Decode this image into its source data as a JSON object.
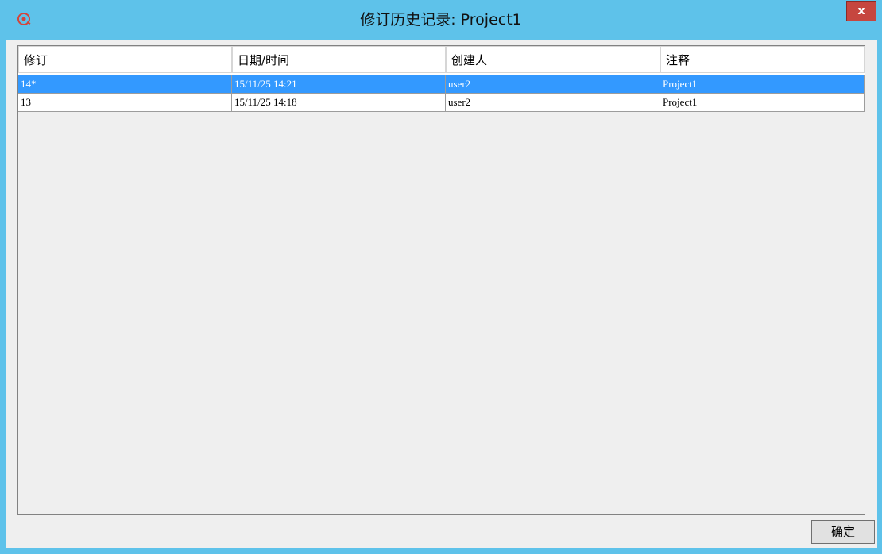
{
  "window": {
    "title": "修订历史记录: Project1",
    "close_label": "x",
    "app_icon": "app-logo-icon"
  },
  "table": {
    "columns": [
      "修订",
      "日期/时间",
      "创建人",
      "注释"
    ],
    "rows": [
      {
        "revision": "14*",
        "datetime": "15/11/25 14:21",
        "creator": "user2",
        "comment": "Project1",
        "selected": true
      },
      {
        "revision": "13",
        "datetime": "15/11/25 14:18",
        "creator": "user2",
        "comment": "Project1",
        "selected": false
      }
    ]
  },
  "footer": {
    "ok_label": "确定"
  },
  "colors": {
    "titlebar": "#5ec2ea",
    "selection": "#3399ff",
    "close": "#c6463f"
  }
}
